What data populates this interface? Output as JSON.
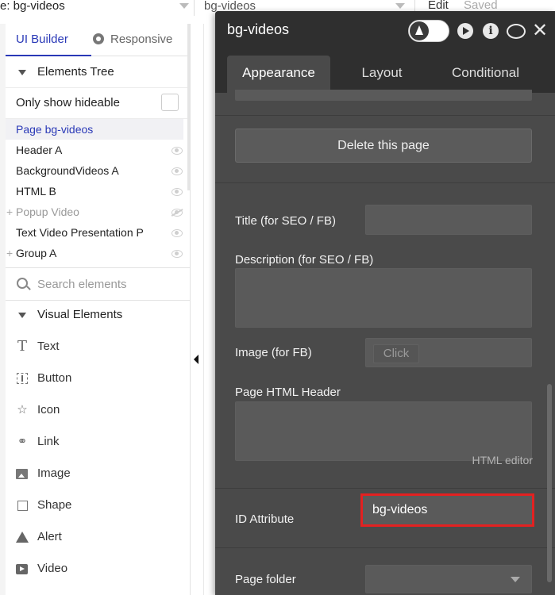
{
  "topbar": {
    "page_label": "e: bg-videos",
    "page_selector_value": "bg-videos",
    "edit": "Edit",
    "saved": "Saved"
  },
  "left_panel": {
    "tabs": {
      "ui_builder": "UI Builder",
      "responsive": "Responsive"
    },
    "elements_tree": "Elements Tree",
    "only_show_hideable": "Only show hideable",
    "tree": [
      {
        "label": "Page bg-videos",
        "selected": true,
        "eye": false,
        "plus": false,
        "dim": false
      },
      {
        "label": "Header A",
        "selected": false,
        "eye": true,
        "plus": false,
        "dim": false
      },
      {
        "label": "BackgroundVideos A",
        "selected": false,
        "eye": true,
        "plus": false,
        "dim": false
      },
      {
        "label": "HTML B",
        "selected": false,
        "eye": true,
        "plus": false,
        "dim": false
      },
      {
        "label": "Popup Video",
        "selected": false,
        "eye": true,
        "plus": true,
        "dim": true
      },
      {
        "label": "Text Video Presentation P",
        "selected": false,
        "eye": true,
        "plus": false,
        "dim": false
      },
      {
        "label": "Group A",
        "selected": false,
        "eye": true,
        "plus": true,
        "dim": false
      }
    ],
    "search_placeholder": "Search elements",
    "visual_elements": "Visual Elements",
    "elements": [
      {
        "label": "Text",
        "icon": "text-icon"
      },
      {
        "label": "Button",
        "icon": "button-icon"
      },
      {
        "label": "Icon",
        "icon": "star-icon"
      },
      {
        "label": "Link",
        "icon": "link-icon"
      },
      {
        "label": "Image",
        "icon": "image-icon"
      },
      {
        "label": "Shape",
        "icon": "shape-icon"
      },
      {
        "label": "Alert",
        "icon": "alert-icon"
      },
      {
        "label": "Video",
        "icon": "video-icon"
      }
    ]
  },
  "editor": {
    "title": "bg-videos",
    "tabs": {
      "appearance": "Appearance",
      "layout": "Layout",
      "conditional": "Conditional"
    },
    "delete_button": "Delete this page",
    "fields": {
      "title_label": "Title (for SEO / FB)",
      "title_value": "",
      "description_label": "Description (for SEO / FB)",
      "image_label": "Image (for FB)",
      "image_button": "Click",
      "html_header_label": "Page HTML Header",
      "html_editor": "HTML editor",
      "id_label": "ID Attribute",
      "id_value": "bg-videos",
      "folder_label": "Page folder",
      "folder_value": ""
    },
    "colors": {
      "panel_bg": "#4a4a4a",
      "header_bg": "#2f2f2f",
      "highlight": "#e32121",
      "accent": "#2a39b7"
    }
  }
}
